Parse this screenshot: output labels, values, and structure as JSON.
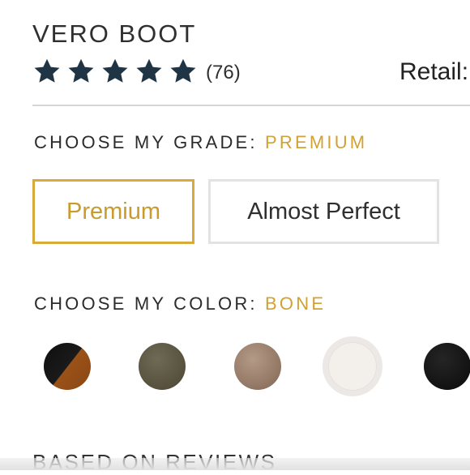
{
  "product": {
    "title": "VERO BOOT",
    "rating": 5,
    "review_count": "(76)",
    "retail_label": "Retail:"
  },
  "grade": {
    "label": "CHOOSE MY GRADE:",
    "selected": "PREMIUM",
    "options": [
      "Premium",
      "Almost Perfect"
    ]
  },
  "color": {
    "label": "CHOOSE MY COLOR:",
    "selected": "BONE",
    "swatches": [
      "black-cognac",
      "olive",
      "taupe",
      "bone",
      "black"
    ]
  },
  "reviews_heading": "BASED ON REVIEWS",
  "colors": {
    "accent": "#d0a234",
    "star": "#1f3445",
    "selected_border": "#d9a93a",
    "unselected_border": "#e3e3e3"
  }
}
